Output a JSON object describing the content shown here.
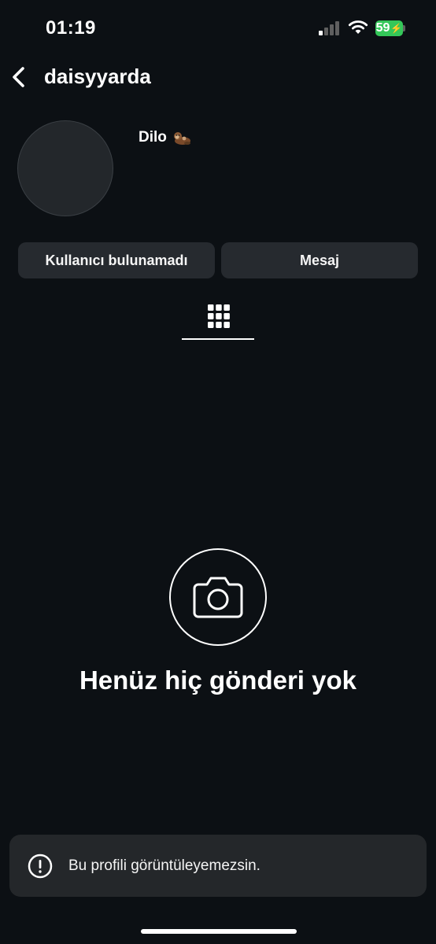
{
  "status_bar": {
    "time": "01:19",
    "battery": "59",
    "battery_color": "#34c759"
  },
  "header": {
    "username": "daisyyarda",
    "back_icon": "chevron-left-icon"
  },
  "profile": {
    "display_name": "Dilo",
    "emoji_icon": "otter-emoji-icon"
  },
  "actions": {
    "primary_label": "Kullanıcı bulunamadı",
    "message_label": "Mesaj"
  },
  "tabs": {
    "grid_icon": "grid-icon"
  },
  "empty_state": {
    "icon": "camera-icon",
    "title": "Henüz hiç gönderi yok"
  },
  "toast": {
    "icon": "alert-circle-icon",
    "message": "Bu profili görüntüleyemezsin."
  },
  "colors": {
    "background": "#0c1014",
    "button_bg": "#262a2f",
    "toast_bg": "#24272a"
  }
}
